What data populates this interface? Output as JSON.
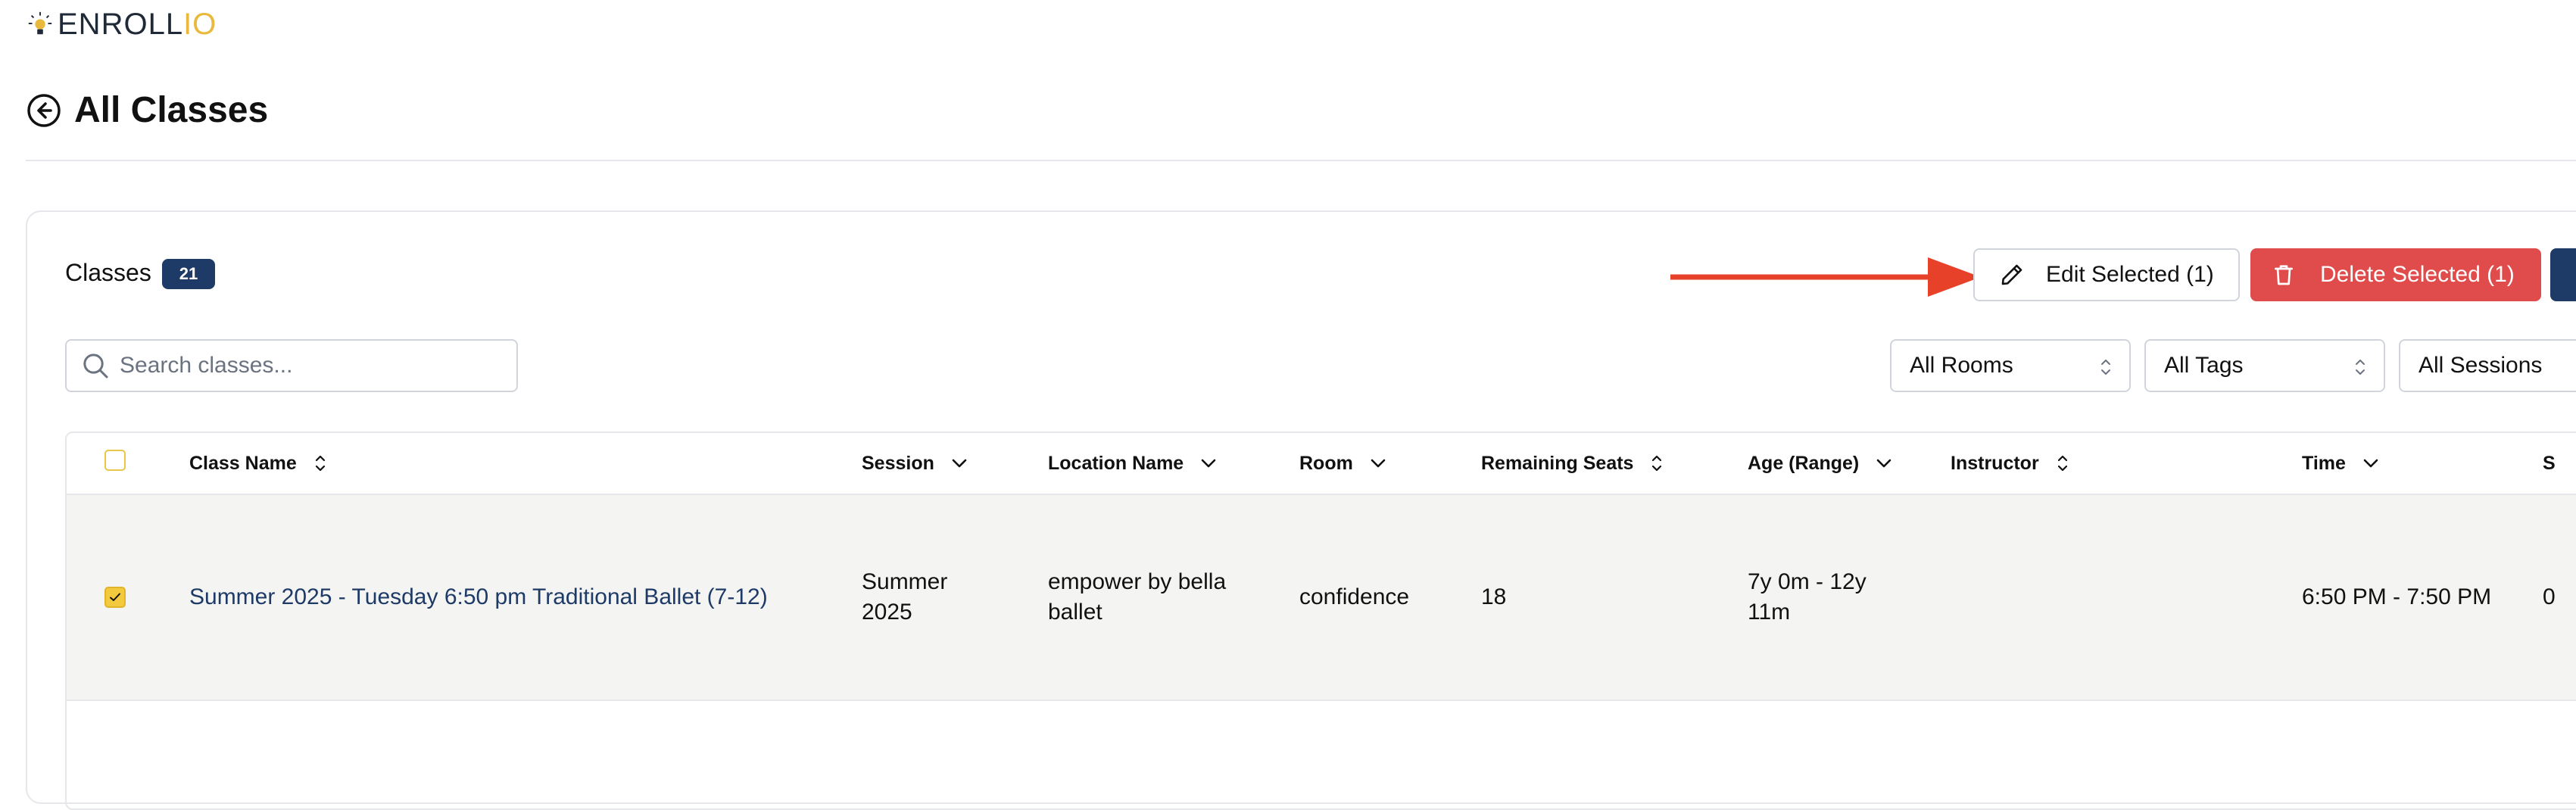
{
  "brand": {
    "logo_part1": "ENROLL",
    "logo_part2": "IO",
    "accent": "#e8b93a"
  },
  "page": {
    "title": "All Classes"
  },
  "toolbar": {
    "section_label": "Classes",
    "count": "21",
    "edit_label": "Edit Selected (1)",
    "delete_label": "Delete Selected (1)"
  },
  "search": {
    "placeholder": "Search classes..."
  },
  "filters": {
    "rooms": "All Rooms",
    "tags": "All Tags",
    "sessions": "All Sessions"
  },
  "table": {
    "headers": {
      "class_name": "Class Name",
      "session": "Session",
      "location": "Location Name",
      "room": "Room",
      "seats": "Remaining Seats",
      "age": "Age (Range)",
      "instructor": "Instructor",
      "time": "Time",
      "next": "S"
    },
    "rows": [
      {
        "selected": true,
        "class_name": "Summer 2025 - Tuesday 6:50 pm Traditional Ballet (7-12)",
        "session_l1": "Summer",
        "session_l2": "2025",
        "location_l1": "empower by bella",
        "location_l2": "ballet",
        "room": "confidence",
        "seats": "18",
        "age_l1": "7y 0m - 12y",
        "age_l2": "11m",
        "instructor": "",
        "time": "6:50 PM - 7:50 PM",
        "next": "0"
      }
    ]
  },
  "colors": {
    "primary": "#1e3a66",
    "danger": "#e04b4b",
    "annotation_arrow": "#e8412a",
    "checkbox": "#f3c93d"
  }
}
